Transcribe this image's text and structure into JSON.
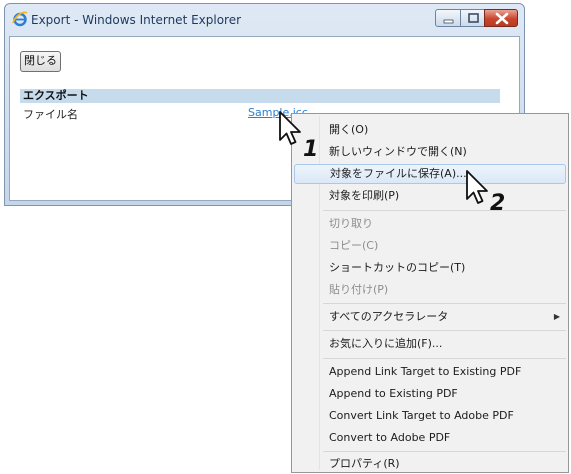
{
  "window": {
    "title": "Export - Windows Internet Explorer",
    "close_button_label": "閉じる",
    "section_title": "エクスポート",
    "file_label": "ファイル名",
    "file_link": "Sample.icc"
  },
  "context_menu": {
    "items": [
      {
        "label": "開く(O)",
        "state": "normal"
      },
      {
        "label": "新しいウィンドウで開く(N)",
        "state": "normal"
      },
      {
        "label": "対象をファイルに保存(A)...",
        "state": "highlighted"
      },
      {
        "label": "対象を印刷(P)",
        "state": "normal"
      },
      {
        "label": "切り取り",
        "state": "disabled"
      },
      {
        "label": "コピー(C)",
        "state": "disabled"
      },
      {
        "label": "ショートカットのコピー(T)",
        "state": "normal"
      },
      {
        "label": "貼り付け(P)",
        "state": "disabled"
      },
      {
        "label": "すべてのアクセラレータ",
        "state": "normal",
        "submenu": true
      },
      {
        "label": "お気に入りに追加(F)...",
        "state": "normal"
      },
      {
        "label": "Append Link Target to Existing PDF",
        "state": "normal"
      },
      {
        "label": "Append to Existing PDF",
        "state": "normal"
      },
      {
        "label": "Convert Link Target to Adobe PDF",
        "state": "normal"
      },
      {
        "label": "Convert to Adobe PDF",
        "state": "normal"
      },
      {
        "label": "プロパティ(R)",
        "state": "normal"
      }
    ]
  },
  "annotations": {
    "step1": "1",
    "step2": "2"
  },
  "icons": {
    "browser": "internet-explorer-icon",
    "minimize": "minimize-icon",
    "maximize": "maximize-icon",
    "close": "close-icon",
    "submenu": "submenu-arrow-icon",
    "pointer": "mouse-pointer-icon"
  },
  "colors": {
    "link": "#2d7fd0",
    "section_bar": "#c6dced",
    "menu_highlight_border": "#a8c8ec",
    "close_button": "#c8462f"
  }
}
